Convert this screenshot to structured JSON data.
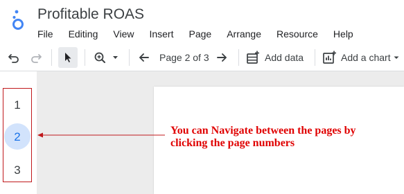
{
  "app": {
    "title": "Profitable ROAS"
  },
  "menu": [
    "File",
    "Editing",
    "View",
    "Insert",
    "Page",
    "Arrange",
    "Resource",
    "Help"
  ],
  "toolbar": {
    "page_indicator": "Page 2 of 3",
    "add_data_label": "Add data",
    "add_chart_label": "Add a chart"
  },
  "pages": [
    {
      "number": "1",
      "active": false
    },
    {
      "number": "2",
      "active": true
    },
    {
      "number": "3",
      "active": false
    }
  ],
  "annotation": {
    "text": "You can Navigate between the pages by clicking the page numbers",
    "color": "#e00000"
  },
  "colors": {
    "accent": "#1a73e8",
    "highlight_border": "#c0181b"
  }
}
